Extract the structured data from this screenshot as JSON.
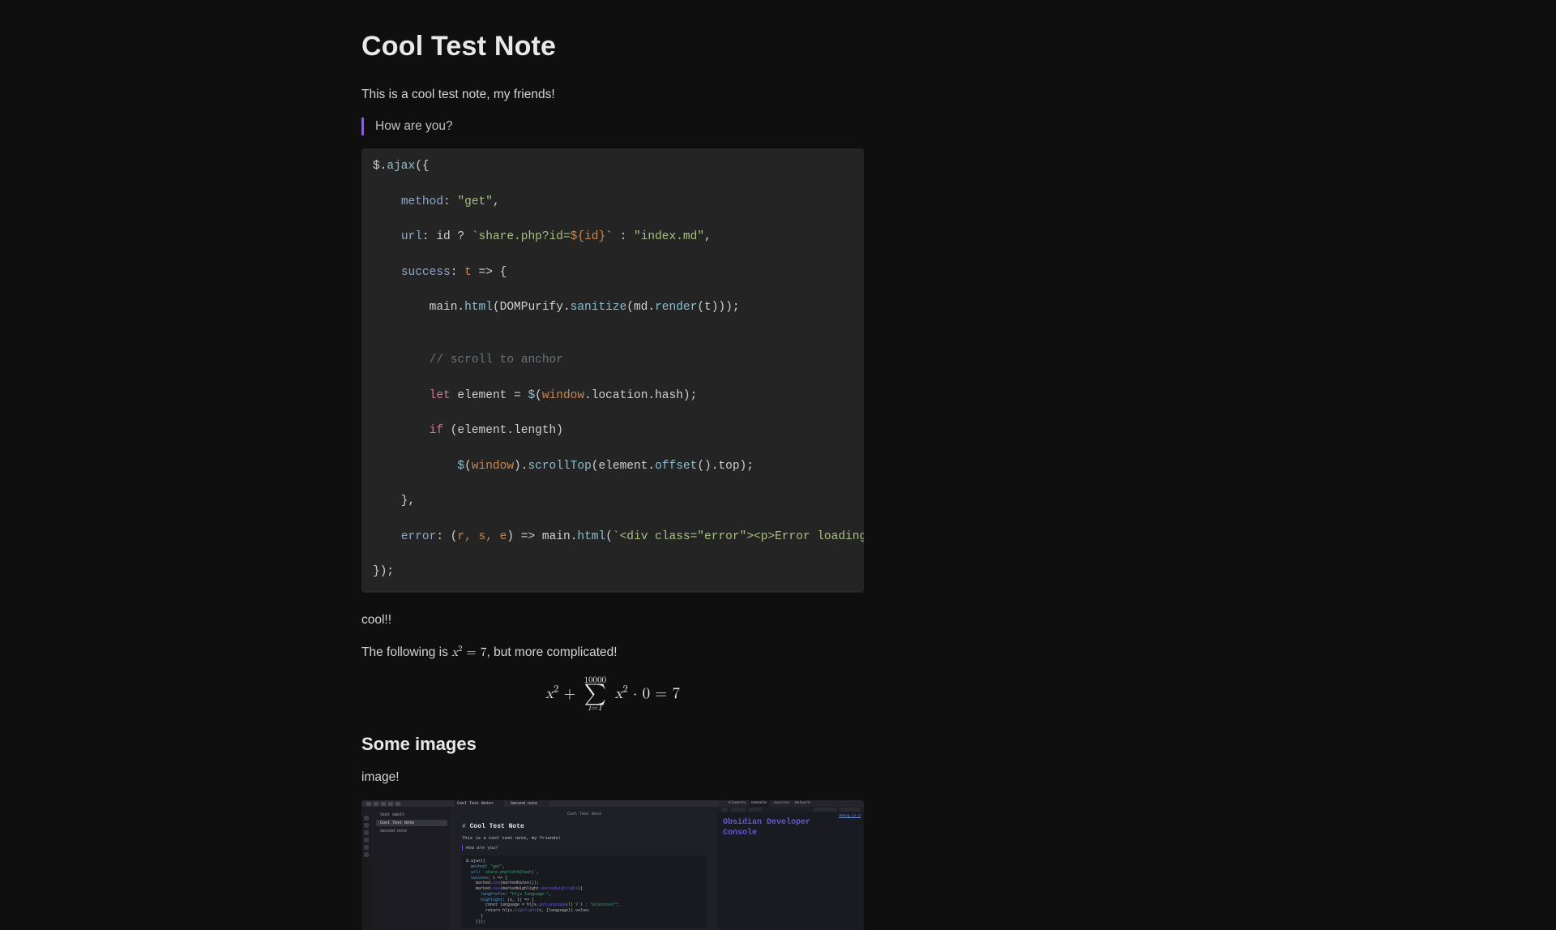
{
  "title": "Cool Test Note",
  "intro": "This is a cool test note, my friends!",
  "quote": "How are you?",
  "code": {
    "l1": {
      "a": "$.",
      "b": "ajax",
      "c": "({"
    },
    "l2": {
      "a": "    ",
      "b": "method",
      "c": ": ",
      "d": "\"get\"",
      "e": ","
    },
    "l3": {
      "a": "    ",
      "b": "url",
      "c": ": id ? ",
      "d": "`share.php?id=",
      "e": "${id}",
      "f": "`",
      "g": " : ",
      "h": "\"index.md\"",
      "i": ","
    },
    "l4": {
      "a": "    ",
      "b": "success",
      "c": ": ",
      "d": "t",
      "e": " => {"
    },
    "l5": {
      "a": "        main.",
      "b": "html",
      "c": "(DOMPurify.",
      "d": "sanitize",
      "e": "(md.",
      "f": "render",
      "g": "(t)));"
    },
    "l6": "",
    "l7": {
      "a": "        ",
      "b": "// scroll to anchor"
    },
    "l8": {
      "a": "        ",
      "b": "let",
      "c": " element = ",
      "d": "$",
      "e": "(",
      "f": "window",
      "g": ".location.hash);"
    },
    "l9": {
      "a": "        ",
      "b": "if",
      "c": " (element.length)"
    },
    "l10": {
      "a": "            ",
      "b": "$",
      "c": "(",
      "d": "window",
      "e": ").",
      "f": "scrollTop",
      "g": "(element.",
      "h": "offset",
      "i": "().top);"
    },
    "l11": "    },",
    "l12": {
      "a": "    ",
      "b": "error",
      "c": ": (",
      "d": "r, s, e",
      "e": ") => main.",
      "f": "html",
      "g": "(",
      "h": "`<div class=\"error\"><p>Error loading "
    },
    "l13": "});"
  },
  "after_code": "cool!!",
  "math_line": {
    "pre": "The following is ",
    "eq": "x",
    "sup": "2",
    "mid": " = 7",
    "post": ", but more complicated!"
  },
  "display_math": {
    "x": "x",
    "sup": "2",
    "plus": " + ",
    "upper": "10000",
    "sigma": "∑",
    "lower": "i=1",
    "rest1": "x",
    "rest_sup": "2",
    "dot": " · 0 = 7"
  },
  "h2": "Some images",
  "img_label": "image!",
  "shot": {
    "vault": "test vault",
    "file_active": "Cool Test Note",
    "file_other": "Second note",
    "tab1": "Cool Test Note",
    "tab2": "Second note",
    "center_tabline": "Cool Test Note",
    "h1": "Cool Test Note",
    "h1_hash": "# ",
    "p": "This is a cool test note, my friends!",
    "bq": "How are you?",
    "code": {
      "l1": "$.ajax({",
      "l2p": "method",
      "l2s": "\"get\"",
      "l3p": "url",
      "l3s": "`share.php?id=${hash}`",
      "l4p": "success",
      "l4t": "t => {",
      "l5a": "marked.",
      "l5b": "use",
      "l5c": "(markedKatex());",
      "l6a": "marked.",
      "l6b": "use",
      "l6c": "(markedHighlight.",
      "l6d": "markedHighlight",
      "l6e": "({",
      "l7p": "langPrefix",
      "l7s": "\"hljs language-\"",
      "l8p": "highlight",
      "l8t": "(s, l) => {",
      "l9a": "const language = hljs.",
      "l9b": "getLanguage",
      "l9c": "(l) ? l : ",
      "l9d": "\"plaintext\"",
      "l9e": ";",
      "l10a": "return hljs.",
      "l10b": "highlight",
      "l10c": "(s, {language}).value;",
      "l11": "}",
      "l12": "}));"
    },
    "dev": {
      "tabs": [
        "Elements",
        "Console",
        "Sources",
        "Network"
      ],
      "log_l1": "Obsidian Developer",
      "log_l2": "Console",
      "issue": "debug.js:2"
    }
  }
}
